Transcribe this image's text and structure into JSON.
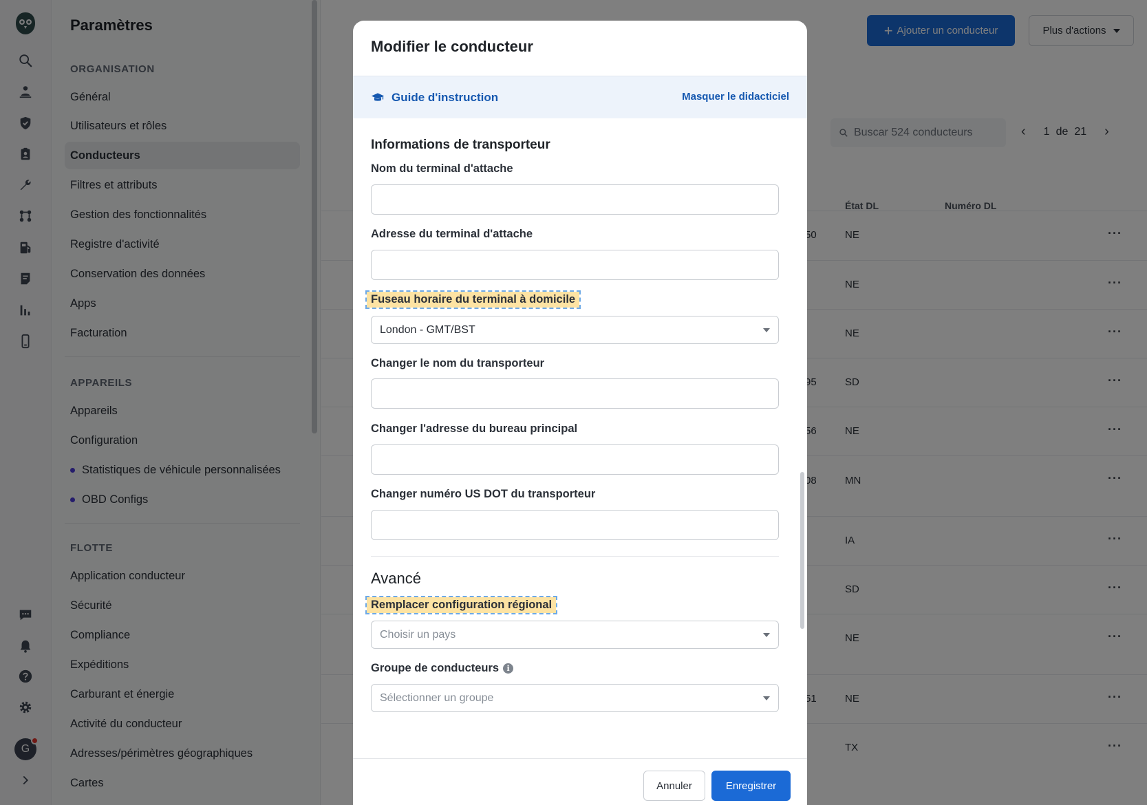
{
  "settings": {
    "title": "Paramètres",
    "organisation_header": "ORGANISATION",
    "organisation_items": [
      "Général",
      "Utilisateurs et rôles",
      "Conducteurs",
      "Filtres et attributs",
      "Gestion des fonctionnalités",
      "Registre d'activité",
      "Conservation des données",
      "Apps",
      "Facturation"
    ],
    "active_item": "Conducteurs",
    "appareils_header": "APPAREILS",
    "appareils_items": [
      "Appareils",
      "Configuration",
      "Statistiques de véhicule personnalisées",
      "OBD Configs"
    ],
    "flotte_header": "FLOTTE",
    "flotte_items": [
      "Application conducteur",
      "Sécurité",
      "Compliance",
      "Expéditions",
      "Carburant et énergie",
      "Activité du conducteur",
      "Adresses/périmètres géographiques",
      "Cartes"
    ]
  },
  "avatar": {
    "initial": "G"
  },
  "main": {
    "add_button": "Ajouter un conducteur",
    "more_button": "Plus d'actions",
    "search_placeholder": "Buscar 524 conducteurs",
    "pager": {
      "current": "1",
      "of": "de",
      "total": "21"
    },
    "columns": {
      "dl_state": "État DL",
      "dl_number": "Numéro DL"
    },
    "rows": [
      {
        "frag": "50",
        "state": "NE"
      },
      {
        "frag": "",
        "state": "NE"
      },
      {
        "frag": "",
        "state": "NE"
      },
      {
        "frag": "95",
        "state": "SD"
      },
      {
        "frag": "56",
        "state": "NE"
      },
      {
        "frag": "08",
        "state": "MN"
      },
      {
        "frag": "",
        "state": "IA"
      },
      {
        "frag": "",
        "state": "SD"
      },
      {
        "frag": "",
        "state": "NE"
      },
      {
        "frag": "51",
        "state": "NE"
      },
      {
        "frag": "",
        "state": "TX"
      }
    ],
    "row_menu": "···"
  },
  "modal": {
    "title": "Modifier le conducteur",
    "guide_label": "Guide d'instruction",
    "guide_hide": "Masquer le didacticiel",
    "section_title": "Informations de transporteur",
    "fields": {
      "home_terminal_name": "Nom du terminal d'attache",
      "home_terminal_address": "Adresse du terminal d'attache",
      "home_terminal_tz": "Fuseau horaire du terminal à domicile",
      "tz_value": "London - GMT/BST",
      "carrier_name": "Changer le nom du transporteur",
      "main_office_address": "Changer l'adresse du bureau principal",
      "us_dot": "Changer numéro US DOT du transporteur"
    },
    "advanced_title": "Avancé",
    "locale_label": "Remplacer configuration régional",
    "locale_placeholder": "Choisir un pays",
    "group_label": "Groupe de conducteurs",
    "group_placeholder": "Sélectionner un groupe",
    "cancel": "Annuler",
    "save": "Enregistrer"
  }
}
